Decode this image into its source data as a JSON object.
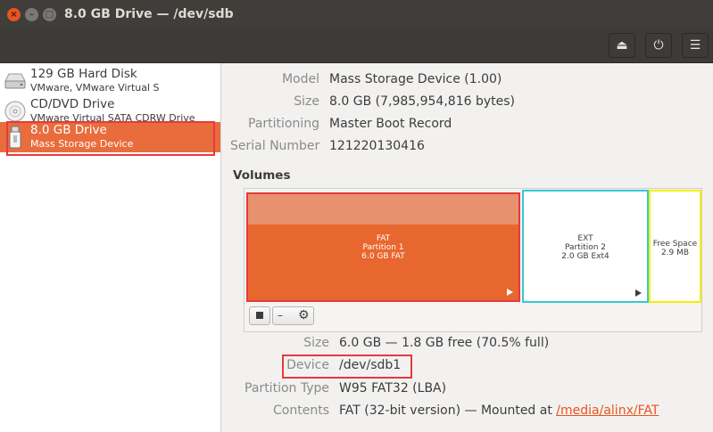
{
  "window": {
    "title": "8.0 GB Drive — /dev/sdb",
    "close_glyph": "×",
    "minimize_glyph": "–",
    "maximize_glyph": "□"
  },
  "header_buttons": {
    "eject_icon": "⏏",
    "power_icon": "⏻",
    "menu_icon": "☰"
  },
  "devices": [
    {
      "name": "129 GB Hard Disk",
      "sub": "VMware, VMware Virtual S",
      "icon": "hard-disk-icon"
    },
    {
      "name": "CD/DVD Drive",
      "sub": "VMware Virtual SATA CDRW Drive",
      "icon": "optical-drive-icon"
    },
    {
      "name": "8.0 GB Drive",
      "sub": "Mass Storage Device",
      "icon": "usb-drive-icon",
      "selected": true
    }
  ],
  "drive_info": {
    "model_label": "Model",
    "model": "Mass Storage Device (1.00)",
    "size_label": "Size",
    "size": "8.0 GB (7,985,954,816 bytes)",
    "partitioning_label": "Partitioning",
    "partitioning": "Master Boot Record",
    "serial_label": "Serial Number",
    "serial": "121220130416"
  },
  "volumes": {
    "heading": "Volumes",
    "items": [
      {
        "line1": "FAT",
        "line2": "Partition 1",
        "line3": "6.0 GB FAT"
      },
      {
        "line1": "EXT",
        "line2": "Partition 2",
        "line3": "2.0 GB Ext4"
      },
      {
        "line1": "Free Space",
        "line2": "2.9 MB"
      }
    ]
  },
  "toolbar": {
    "minus_glyph": "–",
    "gear_glyph": "⚙"
  },
  "partition_info": {
    "size_label": "Size",
    "size": "6.0 GB — 1.8 GB free (70.5% full)",
    "device_label": "Device",
    "device": "/dev/sdb1",
    "type_label": "Partition Type",
    "type": "W95 FAT32 (LBA)",
    "contents_label": "Contents",
    "contents_prefix": "FAT (32-bit version) — Mounted at ",
    "mount_link": "/media/alinx/FAT"
  },
  "colors": {
    "accent": "#e95420",
    "selected_partition": "#e8672f",
    "highlight_red": "#e8383d",
    "highlight_cyan": "#35c8d6",
    "highlight_yellow": "#f3f000"
  }
}
